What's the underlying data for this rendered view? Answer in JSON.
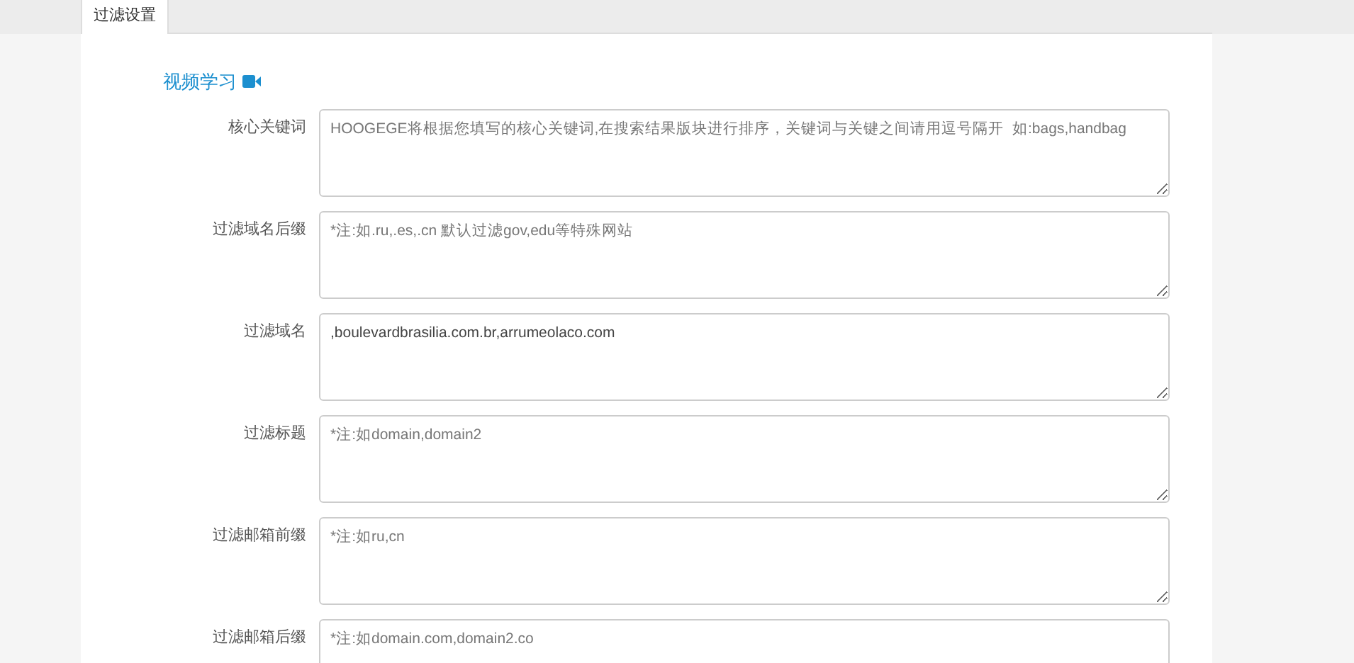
{
  "tabs": [
    {
      "label": "过滤设置",
      "selected": true
    }
  ],
  "heading": {
    "title": "视频学习"
  },
  "fields": [
    {
      "label": "核心关键词",
      "placeholder": "HOOGEGE将根据您填写的核心关键词,在搜索结果版块进行排序，关键词与关键之间请用逗号隔开  如:bags,handbag"
    },
    {
      "label": "过滤域名后缀",
      "placeholder": "*注:如.ru,.es,.cn 默认过滤gov,edu等特殊网站"
    },
    {
      "label": "过滤域名",
      "value": ",boulevardbrasilia.com.br,arrumeolaco.com"
    },
    {
      "label": "过滤标题",
      "placeholder": "*注:如domain,domain2"
    },
    {
      "label": "过滤邮箱前缀",
      "placeholder": "*注:如ru,cn"
    },
    {
      "label": "过滤邮箱后缀",
      "placeholder": "*注:如domain.com,domain2.co"
    }
  ]
}
